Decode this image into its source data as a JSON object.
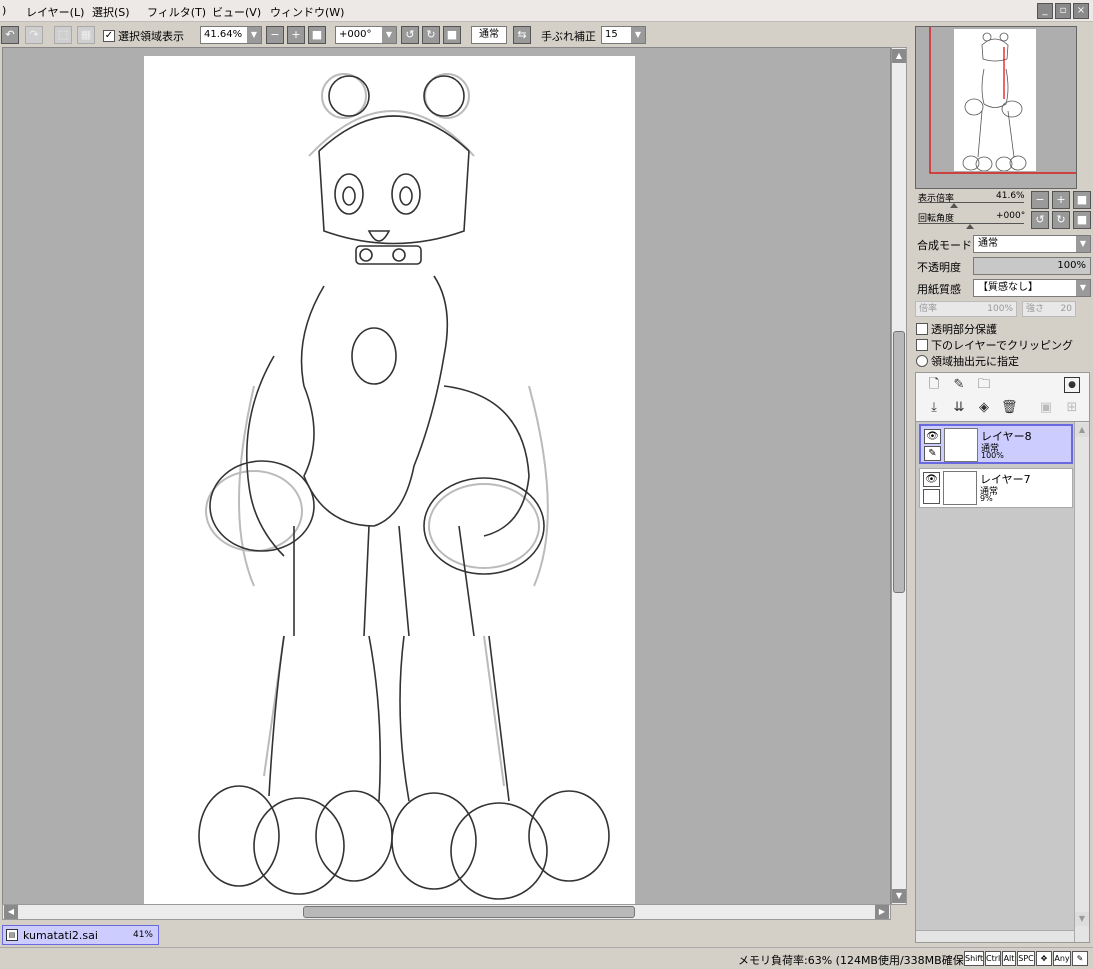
{
  "menu": {
    "items": [
      "レイヤー(L)",
      "選択(S)",
      "フィルタ(T)",
      "ビュー(V)",
      "ウィンドウ(W)"
    ],
    "partial_left": ")"
  },
  "toolbar": {
    "show_selection_label": "選択領域表示",
    "zoom_value": "41.64%",
    "rotation_value": "+000°",
    "mode_button": "通常",
    "stabilizer_label": "手ぶれ補正",
    "stabilizer_value": "15"
  },
  "navigator": {
    "zoom_label": "表示倍率",
    "zoom_value": "41.6%",
    "rotate_label": "回転角度",
    "rotate_value": "+000°"
  },
  "layer_props": {
    "blend_label": "合成モード",
    "blend_value": "通常",
    "opacity_label": "不透明度",
    "opacity_value": "100%",
    "paper_label": "用紙質感",
    "paper_value": "【質感なし】",
    "scale_label": "倍率",
    "scale_value": "100%",
    "strength_label": "強さ",
    "strength_value": "20",
    "protect_alpha": "透明部分保護",
    "clipping": "下のレイヤーでクリッピング",
    "selection_source": "領域抽出元に指定"
  },
  "layers": [
    {
      "name": "レイヤー8",
      "mode": "通常",
      "opacity": "100%",
      "selected": true
    },
    {
      "name": "レイヤー7",
      "mode": "通常",
      "opacity": "9%",
      "selected": false
    }
  ],
  "document_tab": {
    "filename": "kumatati2.sai",
    "zoom": "41%"
  },
  "status": {
    "memory": "メモリ負荷率:63% (124MB使用/338MB確保)",
    "keys": [
      "Shift",
      "Ctrl",
      "Alt",
      "SPC",
      "Any"
    ]
  },
  "colors": {
    "selection": "#ccccff",
    "selection_border": "#6a6ae0",
    "canvas_bg": "#aeaeae",
    "nav_frame": "#e00000"
  },
  "icons": [
    "undo-icon",
    "redo-icon",
    "zoom-out-icon",
    "zoom-in-icon",
    "reset-icon",
    "rotate-ccw-icon",
    "rotate-cw-icon",
    "flip-icon",
    "eye-icon",
    "pen-icon",
    "new-layer-icon",
    "new-vector-layer-icon",
    "folder-icon",
    "trash-icon",
    "mask-icon"
  ]
}
